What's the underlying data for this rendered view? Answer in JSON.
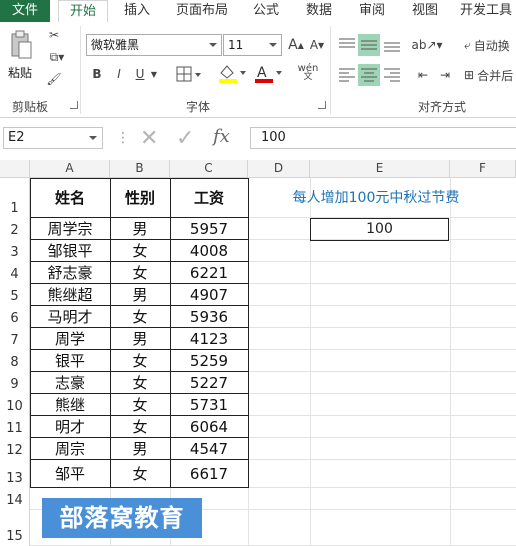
{
  "tabs": [
    "文件",
    "开始",
    "插入",
    "页面布局",
    "公式",
    "数据",
    "审阅",
    "视图",
    "开发工具"
  ],
  "ribbon": {
    "paste_label": "粘贴",
    "font_name": "微软雅黑",
    "font_size": "11",
    "bold": "B",
    "italic": "I",
    "underline": "U",
    "wen": "wén",
    "wrap_text": "自动换",
    "merge": "合并后",
    "groups": {
      "clipboard": "剪贴板",
      "font": "字体",
      "align": "对齐方式"
    }
  },
  "formula_bar": {
    "name_box": "E2",
    "fx": "fx",
    "value": "100"
  },
  "columns": [
    "A",
    "B",
    "C",
    "D",
    "E",
    "F"
  ],
  "rows": [
    "1",
    "2",
    "3",
    "4",
    "5",
    "6",
    "7",
    "8",
    "9",
    "10",
    "11",
    "12",
    "13",
    "14",
    "15"
  ],
  "table": {
    "headers": [
      "姓名",
      "性别",
      "工资"
    ],
    "data": [
      [
        "周学宗",
        "男",
        "5957"
      ],
      [
        "邹银平",
        "女",
        "4008"
      ],
      [
        "舒志豪",
        "女",
        "6221"
      ],
      [
        "熊继超",
        "男",
        "4907"
      ],
      [
        "马明才",
        "女",
        "5936"
      ],
      [
        "周学",
        "男",
        "4123"
      ],
      [
        "银平",
        "女",
        "5259"
      ],
      [
        "志豪",
        "女",
        "5227"
      ],
      [
        "熊继",
        "女",
        "5731"
      ],
      [
        "明才",
        "女",
        "6064"
      ],
      [
        "周宗",
        "男",
        "4547"
      ],
      [
        "邹平",
        "女",
        "6617"
      ]
    ]
  },
  "note": "每人增加100元中秋过节费",
  "input_value": "100",
  "watermark": "部落窝教育",
  "colors": {
    "accent": "#217346",
    "note": "#1b74b5",
    "watermark": "#4a90d9"
  }
}
